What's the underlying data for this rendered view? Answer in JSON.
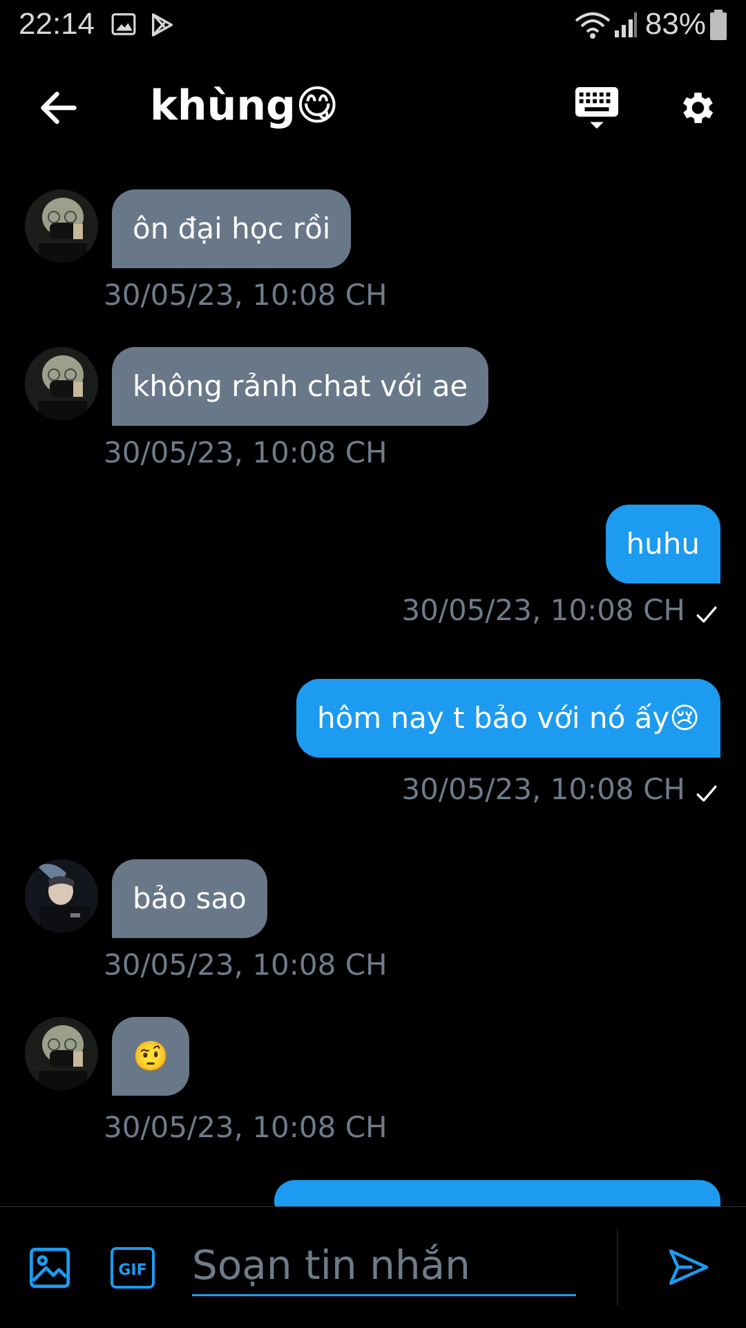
{
  "status_bar": {
    "time": "22:14",
    "battery": "83%"
  },
  "header": {
    "title": "khùng😋"
  },
  "messages": [
    {
      "direction": "in",
      "text": "ôn đại học rồi",
      "timestamp": "30/05/23, 10:08 CH"
    },
    {
      "direction": "in",
      "text": "không rảnh chat với ae",
      "timestamp": "30/05/23, 10:08 CH"
    },
    {
      "direction": "out",
      "text": "huhu",
      "timestamp": "30/05/23, 10:08 CH",
      "status": "sent-check"
    },
    {
      "direction": "out",
      "text": "hôm nay t bảo với nó ấy😢",
      "timestamp": "30/05/23, 10:08 CH",
      "status": "sent-check"
    },
    {
      "direction": "in",
      "text": "bảo sao",
      "timestamp": "30/05/23, 10:08 CH"
    },
    {
      "direction": "in",
      "text": "🤨",
      "timestamp": "30/05/23, 10:08 CH"
    },
    {
      "direction": "out",
      "text": "",
      "timestamp": ""
    }
  ],
  "compose": {
    "placeholder": "Soạn tin nhắn",
    "gif_label": "GIF"
  },
  "colors": {
    "accent": "#1d9bf0",
    "incoming_bubble": "#687888",
    "timestamp": "#6e7c8a",
    "background": "#000000"
  },
  "icons": [
    "back-arrow-icon",
    "keyboard-icon",
    "gear-icon",
    "image-icon",
    "gif-icon",
    "send-icon",
    "check-icon",
    "wifi-icon",
    "signal-icon",
    "battery-icon"
  ]
}
